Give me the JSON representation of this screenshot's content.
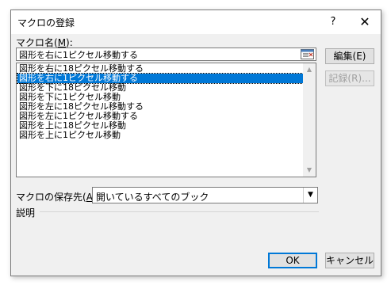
{
  "window": {
    "title": "マクロの登録",
    "help_label": "?",
    "close_label": "✕"
  },
  "macro_name": {
    "label_prefix": "マクロ名(",
    "label_key": "M",
    "label_suffix": "):",
    "value": "図形を右に1ピクセル移動する"
  },
  "macro_list": {
    "items": [
      "図形を右に18ピクセル移動する",
      "図形を右に1ピクセル移動する",
      "図形を下に18ピクセル移動",
      "図形を下に1ピクセル移動",
      "図形を左に18ピクセル移動する",
      "図形を左に1ピクセル移動する",
      "図形を上に18ピクセル移動",
      "図形を上に1ピクセル移動"
    ],
    "selected_index": 1
  },
  "buttons": {
    "edit": "編集(E)",
    "record": "記録(R)...",
    "ok": "OK",
    "cancel": "キャンセル"
  },
  "location": {
    "label_prefix": "マクロの保存先(",
    "label_key": "A",
    "label_suffix": "):",
    "value": "開いているすべてのブック"
  },
  "description": {
    "label": "説明"
  },
  "colors": {
    "selection": "#0078d7",
    "dialog_bg": "#f0f0f0"
  },
  "icons": {
    "scroll_up": "scroll-up-arrow-icon",
    "scroll_down": "scroll-down-arrow-icon",
    "dropdown": "chevron-down-icon",
    "ref": "range-reference-icon"
  }
}
